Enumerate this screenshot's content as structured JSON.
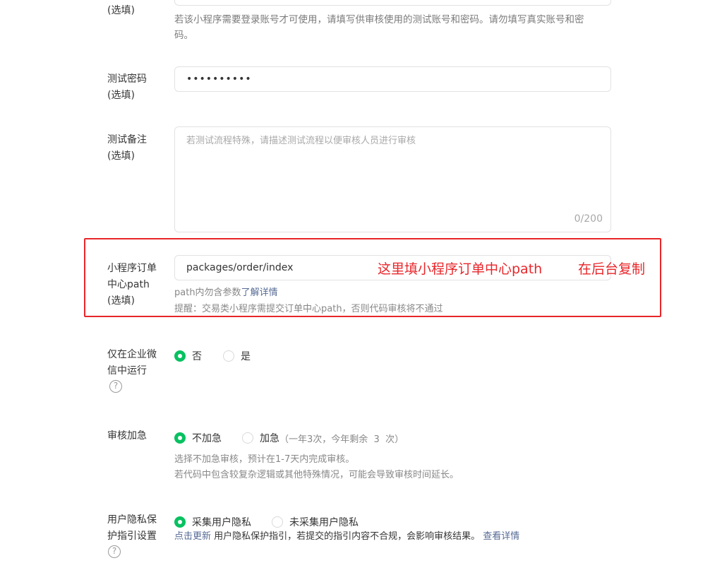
{
  "account": {
    "label_suffix": "(选填)",
    "hint_line1": "若该小程序需要登录账号才可使用，请填写供审核使用的测试账号和密码。请勿填写真实账号和密",
    "hint_line2": "码。"
  },
  "password": {
    "label_line1": "测试密码",
    "label_line2": "(选填)",
    "value": "••••••••••"
  },
  "notes": {
    "label_line1": "测试备注",
    "label_line2": "(选填)",
    "placeholder": "若测试流程特殊，请描述测试流程以便审核人员进行审核",
    "counter": "0/200"
  },
  "order_path": {
    "label_line1": "小程序订单",
    "label_line2": "中心path",
    "label_line3": "(选填)",
    "value": "packages/order/index",
    "hint_prefix": "path内勿含参数",
    "hint_link": "了解详情",
    "reminder": "提醒：交易类小程序需提交订单中心path，否则代码审核将不通过",
    "annotation_1": "这里填小程序订单中心path",
    "annotation_2": "在后台复制",
    "annotation_color": "#e8262a"
  },
  "wecom_only": {
    "label_line1": "仅在企业微",
    "label_line2": "信中运行",
    "help_icon": "question-circle-icon",
    "options": [
      "否",
      "是"
    ],
    "selected": 0
  },
  "expedite": {
    "label": "审核加急",
    "options": [
      "不加急",
      "加急"
    ],
    "expedite_note": "（一年3次，今年剩余  3  次）",
    "selected": 0,
    "hint_line1": "选择不加急审核，预计在1-7天内完成审核。",
    "hint_line2": "若代码中包含较复杂逻辑或其他特殊情况，可能会导致审核时间延长。"
  },
  "privacy": {
    "label_line1": "用户隐私保",
    "label_line2": "护指引设置",
    "help_icon": "question-circle-icon",
    "options": [
      "采集用户隐私",
      "未采集用户隐私"
    ],
    "selected": 0,
    "update_link": "点击更新",
    "hint_text": " 用户隐私保护指引，若提交的指引内容不合规，会影响审核结果。 ",
    "details_link": "查看详情"
  },
  "colors": {
    "accent_green": "#07c160",
    "link_blue": "#576b95",
    "highlight_red": "#e8262a"
  }
}
